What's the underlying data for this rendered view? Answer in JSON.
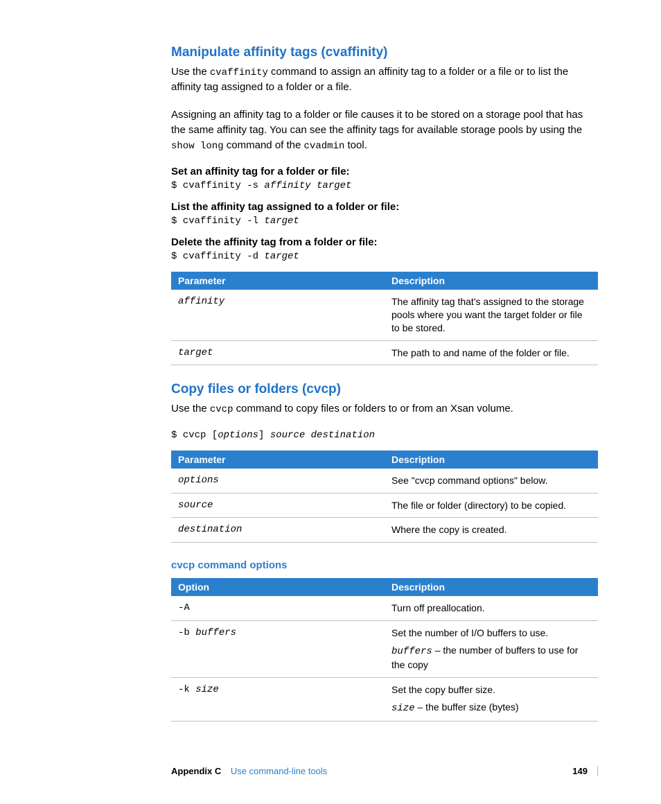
{
  "section1": {
    "heading": "Manipulate affinity tags (cvaffinity)",
    "intro_pre": "Use the ",
    "intro_cmd": "cvaffinity",
    "intro_post": " command to assign an affinity tag to a folder or a file or to list the affinity tag assigned to a folder or a file.",
    "p2_a": "Assigning an affinity tag to a folder or file causes it to be stored on a storage pool that has the same affinity tag. You can see the affinity tags for available storage pools by using the ",
    "p2_cmd1": "show long",
    "p2_b": " command of the ",
    "p2_cmd2": "cvadmin",
    "p2_c": " tool.",
    "sub1_title": "Set an affinity tag for a folder or file:",
    "sub1_cmd_lit": "$ cvaffinity -s ",
    "sub1_cmd_arg": "affinity target",
    "sub2_title": "List the affinity tag assigned to a folder or file:",
    "sub2_cmd_lit": "$ cvaffinity -l ",
    "sub2_cmd_arg": "target",
    "sub3_title": "Delete the affinity tag from a folder or file:",
    "sub3_cmd_lit": "$ cvaffinity -d ",
    "sub3_cmd_arg": "target",
    "table": {
      "h1": "Parameter",
      "h2": "Description",
      "r1p": "affinity",
      "r1d": "The affinity tag that's assigned to the storage pools where you want the target folder or file to be stored.",
      "r2p": "target",
      "r2d": "The path to and name of the folder or file."
    }
  },
  "section2": {
    "heading": "Copy files or folders (cvcp)",
    "intro_pre": "Use the ",
    "intro_cmd": "cvcp",
    "intro_post": " command to copy files or folders to or from an Xsan volume.",
    "cmd_lit1": "$ cvcp [",
    "cmd_arg1": "options",
    "cmd_lit2": "] ",
    "cmd_arg2": "source destination",
    "table": {
      "h1": "Parameter",
      "h2": "Description",
      "r1p": "options",
      "r1d": "See \"cvcp command options\" below.",
      "r2p": "source",
      "r2d": "The file or folder (directory) to be copied.",
      "r3p": "destination",
      "r3d": "Where the copy is created."
    },
    "sub_heading": "cvcp command options",
    "table2": {
      "h1": "Option",
      "h2": "Description",
      "r1o": "-A",
      "r1d": "Turn off preallocation.",
      "r2o_lit": "-b ",
      "r2o_arg": "buffers",
      "r2d": "Set the number of I/O buffers to use.",
      "r2d2_arg": "buffers",
      "r2d2_txt": " – the number of buffers to use for the copy",
      "r3o_lit": "-k ",
      "r3o_arg": "size",
      "r3d": "Set the copy buffer size.",
      "r3d2_arg": "size",
      "r3d2_txt": " – the buffer size (bytes)"
    }
  },
  "footer": {
    "appendix": "Appendix C",
    "title": "Use command-line tools",
    "page": "149"
  }
}
